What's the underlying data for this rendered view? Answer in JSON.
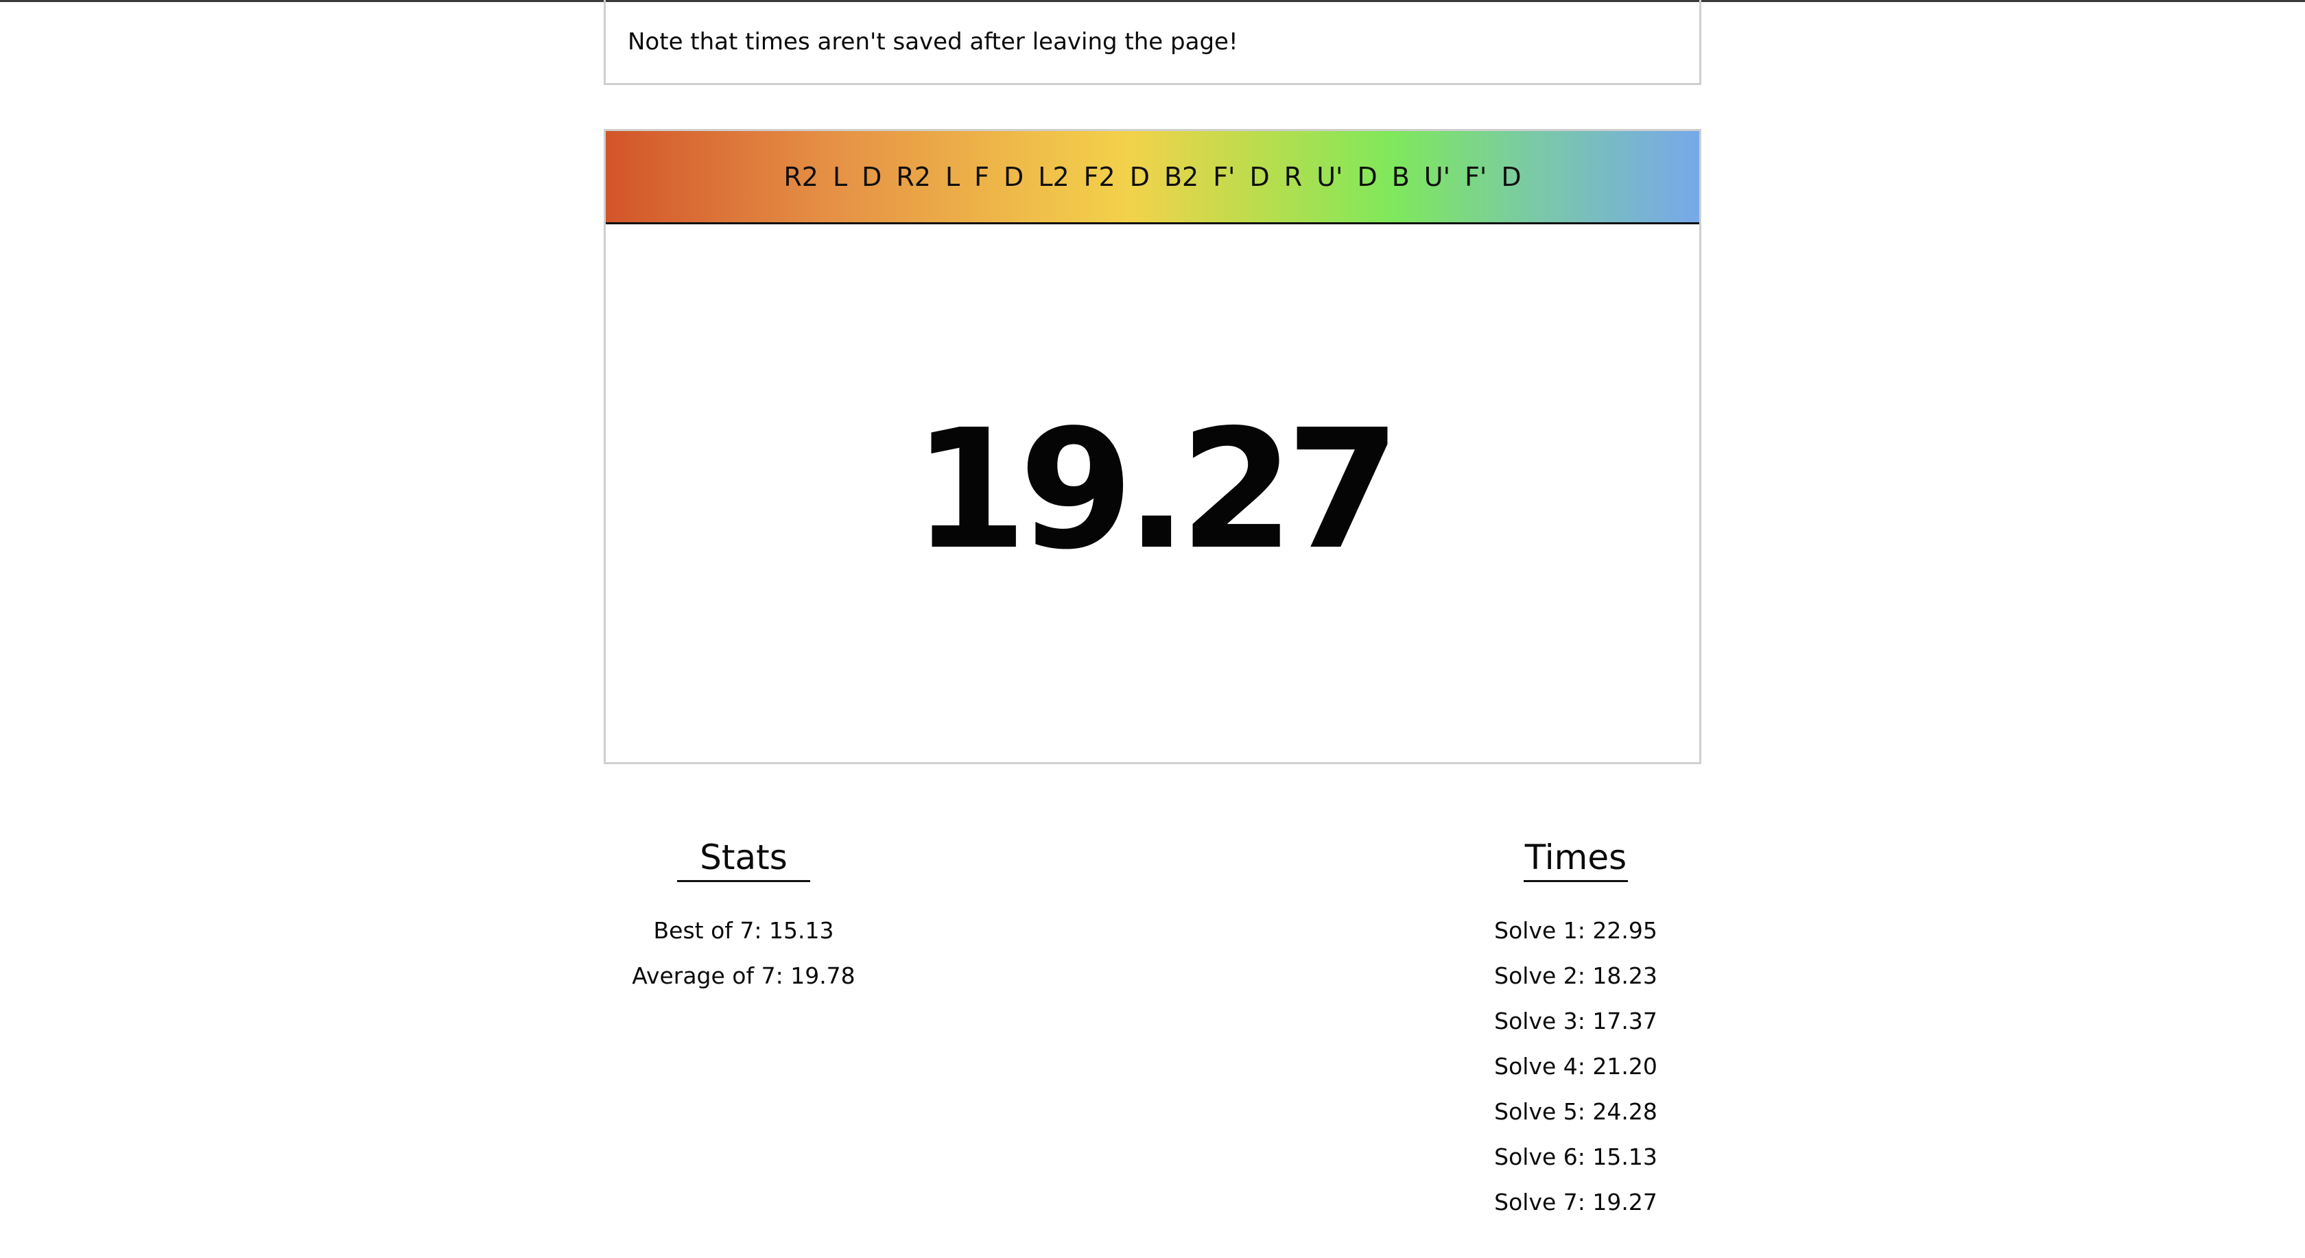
{
  "note": {
    "text": "Note that times aren't saved after leaving the page!"
  },
  "scramble": {
    "moves": [
      "R2",
      "L",
      "D",
      "R2",
      "L",
      "F",
      "D",
      "L2",
      "F2",
      "D",
      "B2",
      "F'",
      "D",
      "R",
      "U'",
      "D",
      "B",
      "U'",
      "F'",
      "D"
    ],
    "gradient_colors": [
      "#d2552a",
      "#f2d24b",
      "#7fe85c",
      "#77a8ea"
    ]
  },
  "timer": {
    "value": "19.27"
  },
  "stats": {
    "title": "Stats",
    "items": [
      "Best of 7: 15.13",
      "Average of 7: 19.78"
    ]
  },
  "times": {
    "title": "Times",
    "items": [
      "Solve 1: 22.95",
      "Solve 2: 18.23",
      "Solve 3: 17.37",
      "Solve 4: 21.20",
      "Solve 5: 24.28",
      "Solve 6: 15.13",
      "Solve 7: 19.27"
    ]
  }
}
